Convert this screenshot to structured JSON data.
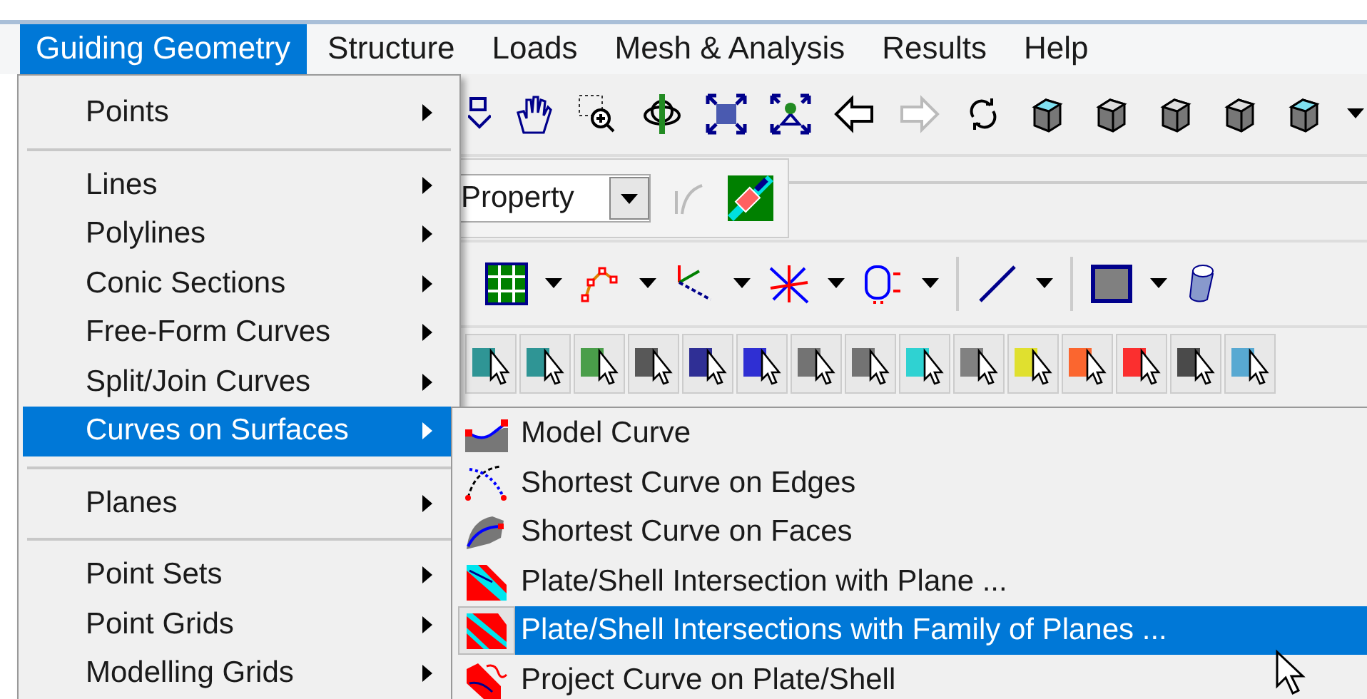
{
  "menubar": [
    {
      "label": "Guiding Geometry",
      "selected": true
    },
    {
      "label": "Structure",
      "selected": false
    },
    {
      "label": "Loads",
      "selected": false
    },
    {
      "label": "Mesh & Analysis",
      "selected": false
    },
    {
      "label": "Results",
      "selected": false
    },
    {
      "label": "Help",
      "selected": false
    }
  ],
  "toolbar": {
    "back_disabled": false,
    "forward_disabled": true,
    "property_field": {
      "value": "Property"
    }
  },
  "menu": {
    "groups": [
      {
        "items": [
          {
            "label": "Points",
            "submenu": true,
            "selected": false
          }
        ]
      },
      {
        "items": [
          {
            "label": "Lines",
            "submenu": true,
            "selected": false
          },
          {
            "label": "Polylines",
            "submenu": true,
            "selected": false
          },
          {
            "label": "Conic Sections",
            "submenu": true,
            "selected": false
          },
          {
            "label": "Free-Form Curves",
            "submenu": true,
            "selected": false
          },
          {
            "label": "Split/Join Curves",
            "submenu": true,
            "selected": false
          },
          {
            "label": "Curves on Surfaces",
            "submenu": true,
            "selected": true
          }
        ]
      },
      {
        "items": [
          {
            "label": "Planes",
            "submenu": true,
            "selected": false
          }
        ]
      },
      {
        "items": [
          {
            "label": "Point Sets",
            "submenu": true,
            "selected": false
          },
          {
            "label": "Point Grids",
            "submenu": true,
            "selected": false
          },
          {
            "label": "Modelling Grids",
            "submenu": true,
            "selected": false
          }
        ]
      }
    ]
  },
  "submenu": {
    "items": [
      {
        "label": "Model Curve",
        "selected": false
      },
      {
        "label": "Shortest Curve on Edges",
        "selected": false
      },
      {
        "label": "Shortest Curve on Faces",
        "selected": false
      },
      {
        "label": "Plate/Shell Intersection with Plane ...",
        "selected": false
      },
      {
        "label": "Plate/Shell Intersections with Family of Planes ...",
        "selected": true
      },
      {
        "label": "Project Curve on Plate/Shell",
        "selected": false
      }
    ]
  }
}
